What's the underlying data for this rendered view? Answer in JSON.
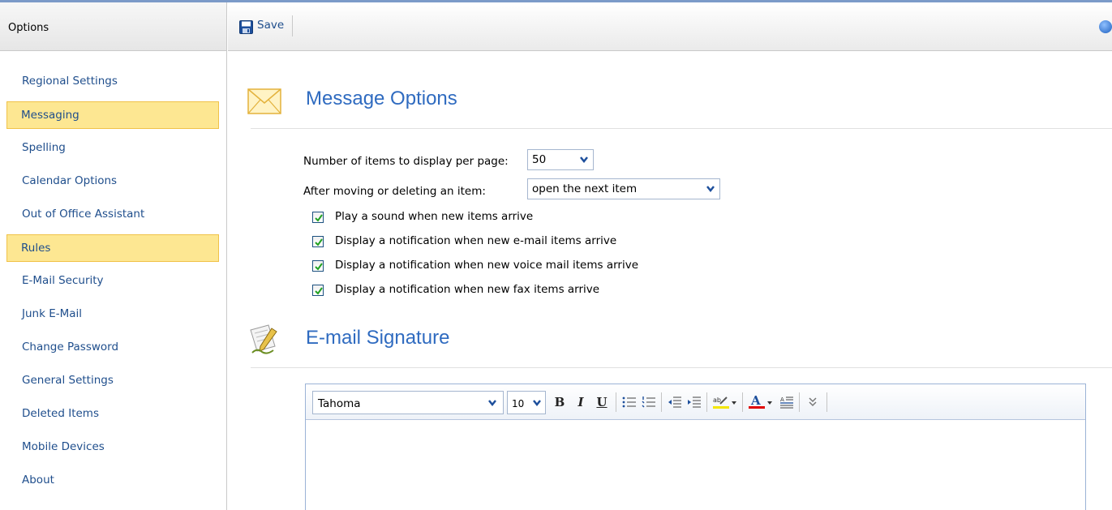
{
  "sidebar": {
    "header": "Options",
    "items": [
      {
        "label": "Regional Settings",
        "active": false
      },
      {
        "label": "Messaging",
        "active": true
      },
      {
        "label": "Spelling",
        "active": false
      },
      {
        "label": "Calendar Options",
        "active": false
      },
      {
        "label": "Out of Office Assistant",
        "active": false
      },
      {
        "label": "Rules",
        "active": true
      },
      {
        "label": "E-Mail Security",
        "active": false
      },
      {
        "label": "Junk E-Mail",
        "active": false
      },
      {
        "label": "Change Password",
        "active": false
      },
      {
        "label": "General Settings",
        "active": false
      },
      {
        "label": "Deleted Items",
        "active": false
      },
      {
        "label": "Mobile Devices",
        "active": false
      },
      {
        "label": "About",
        "active": false
      }
    ]
  },
  "toolbar": {
    "save_label": "Save"
  },
  "message_options": {
    "title": "Message Options",
    "items_per_page_label": "Number of items to display per page:",
    "items_per_page_value": "50",
    "after_move_label": "After moving or deleting an item:",
    "after_move_value": "open the next item",
    "checkboxes": [
      {
        "label": "Play a sound when new items arrive",
        "checked": true
      },
      {
        "label": "Display a notification when new e-mail items arrive",
        "checked": true
      },
      {
        "label": "Display a notification when new voice mail items arrive",
        "checked": true
      },
      {
        "label": "Display a notification when new fax items arrive",
        "checked": true
      }
    ]
  },
  "signature": {
    "title": "E-mail Signature",
    "font_value": "Tahoma",
    "size_value": "10",
    "bold_label": "B",
    "italic_label": "I",
    "underline_label": "U"
  },
  "colors": {
    "accent_title": "#2f6bc0",
    "nav_link": "#1f4e8c",
    "active_bg": "#fde792",
    "active_border": "#f0c248"
  },
  "icons": {
    "save": "floppy-disk-icon",
    "help": "help-globe-icon",
    "message": "envelope-icon",
    "signature": "pen-signature-icon"
  }
}
